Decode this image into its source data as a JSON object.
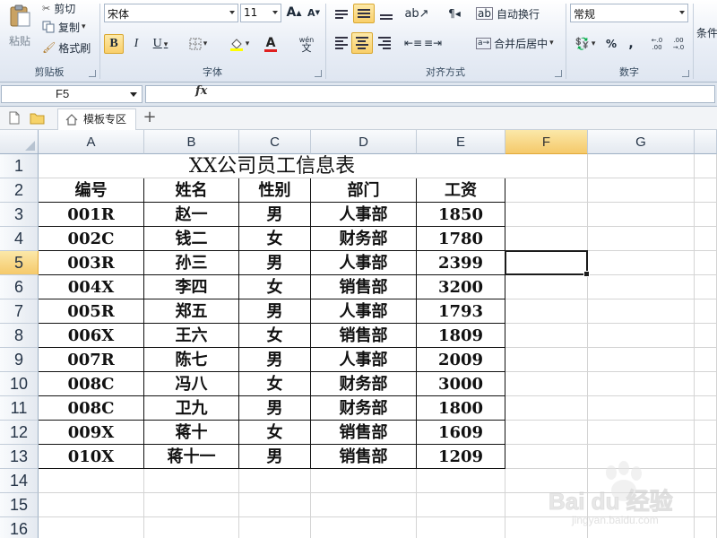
{
  "ribbon": {
    "clipboard": {
      "cut": "剪切",
      "copy": "复制",
      "format_painter": "格式刷",
      "paste": "粘贴",
      "label": "剪贴板"
    },
    "font": {
      "name": "宋体",
      "size": "11",
      "grow": "A",
      "shrink": "A",
      "bold": "B",
      "italic": "I",
      "underline": "U",
      "font_color": "A",
      "wen": "wén",
      "wen_char": "文",
      "label": "字体"
    },
    "alignment": {
      "wrap_text": "自动换行",
      "merge_center": "合并后居中",
      "label": "对齐方式"
    },
    "number": {
      "format": "常规",
      "percent": "%",
      "comma": ",",
      "inc_decimal": "←.0 .00",
      "dec_decimal": ".00 →.0",
      "label": "数字"
    },
    "styles": {
      "conditional": "条件"
    }
  },
  "formula_bar": {
    "name_box": "F5",
    "fx": "fx",
    "formula": ""
  },
  "tabs": {
    "template_tab": "模板专区",
    "add": "+"
  },
  "grid": {
    "columns": [
      "A",
      "B",
      "C",
      "D",
      "E",
      "F",
      "G"
    ],
    "rows": [
      "1",
      "2",
      "3",
      "4",
      "5",
      "6",
      "7",
      "8",
      "9",
      "10",
      "11",
      "12",
      "13",
      "14",
      "15",
      "16"
    ],
    "selected_column": "F",
    "selected_row": "5",
    "title": "XX公司员工信息表",
    "headers": [
      "编号",
      "姓名",
      "性别",
      "部门",
      "工资"
    ],
    "records": [
      [
        "001R",
        "赵一",
        "男",
        "人事部",
        "1850"
      ],
      [
        "002C",
        "钱二",
        "女",
        "财务部",
        "1780"
      ],
      [
        "003R",
        "孙三",
        "男",
        "人事部",
        "2399"
      ],
      [
        "004X",
        "李四",
        "女",
        "销售部",
        "3200"
      ],
      [
        "005R",
        "郑五",
        "男",
        "人事部",
        "1793"
      ],
      [
        "006X",
        "王六",
        "女",
        "销售部",
        "1809"
      ],
      [
        "007R",
        "陈七",
        "男",
        "人事部",
        "2009"
      ],
      [
        "008C",
        "冯八",
        "女",
        "财务部",
        "3000"
      ],
      [
        "008C",
        "卫九",
        "男",
        "财务部",
        "1800"
      ],
      [
        "009X",
        "蒋十",
        "女",
        "销售部",
        "1609"
      ],
      [
        "010X",
        "蒋十一",
        "男",
        "销售部",
        "1209"
      ]
    ]
  },
  "watermark": {
    "brand": "Bai du 经验",
    "url": "jingyan.baidu.com"
  }
}
